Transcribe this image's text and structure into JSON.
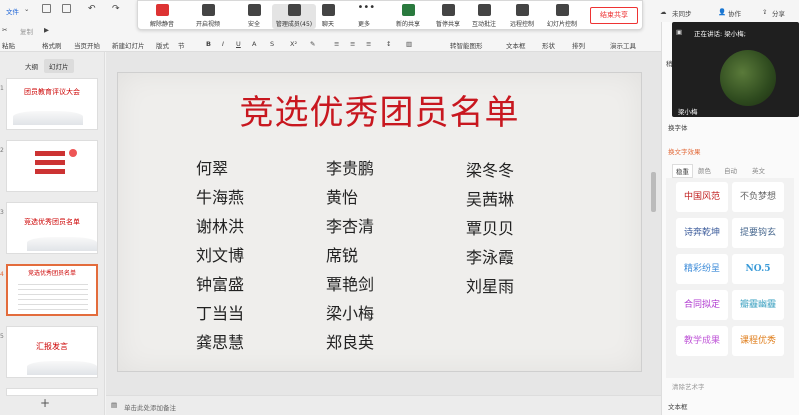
{
  "topbar": {
    "file_menu": "文件",
    "sync": "未同步",
    "collab": "协作",
    "share": "分享"
  },
  "ribbon": {
    "paste": "粘贴",
    "copy": "复制",
    "format": "格式刷",
    "play_from_current": "当页开始",
    "new_slide": "新建幻灯片",
    "layout": "版式",
    "section": "节",
    "smart_graphic": "转智能图形",
    "textbox": "文本框",
    "shape": "形状",
    "arrange": "排列",
    "presenter": "演示工具"
  },
  "meeting": {
    "mute": "解除静音",
    "video": "开启视频",
    "security": "安全",
    "members": "管理成员(45)",
    "chat": "聊天",
    "more": "更多",
    "new_share": "新的共享",
    "pause_share": "暂停共享",
    "annotate": "互动批注",
    "remote": "远程控制",
    "slide_control": "幻灯片控制",
    "end_share": "结束共享"
  },
  "leftpane": {
    "tab_outline": "大纲",
    "tab_slides": "幻灯片",
    "thumbs": [
      {
        "num": "1",
        "title": "团员教育评议大会"
      },
      {
        "num": "2",
        "title": ""
      },
      {
        "num": "3",
        "title": "竞选优秀团员名单"
      },
      {
        "num": "4",
        "title": "竞选优秀团员名单"
      },
      {
        "num": "5",
        "title": "汇报发言"
      }
    ],
    "add": "+"
  },
  "slide": {
    "title": "竞选优秀团员名单",
    "col1": [
      "何翠",
      "牛海燕",
      "谢林洪",
      "刘文博",
      "钟富盛",
      "丁当当",
      "龚思慧"
    ],
    "col2": [
      "李贵鹏",
      "黄怡",
      "李杏清",
      "席锐",
      "覃艳剑",
      "梁小梅",
      "郑良英"
    ],
    "col3": [
      "梁冬冬",
      "吴茜琳",
      "覃贝贝",
      "李泳霞",
      "刘星雨"
    ]
  },
  "notes": {
    "placeholder": "单击此处添加备注"
  },
  "video": {
    "speaking": "正在讲话: 梁小梅;",
    "name": "梁小梅"
  },
  "rightpane": {
    "header": "稍夷",
    "change_font": "换字体",
    "text_effect": "换文字效果",
    "tabs": [
      "稳重",
      "颜色",
      "自动",
      "英文"
    ],
    "samples": [
      "中国风范",
      "不负梦想",
      "诗奔乾坤",
      "提要钩玄",
      "精彩纷呈",
      "NO.5",
      "合同拟定",
      "瓣霾幽霾",
      "教学成果",
      "课程优秀"
    ],
    "clear_art": "清除艺术字",
    "textbox": "文本框"
  }
}
